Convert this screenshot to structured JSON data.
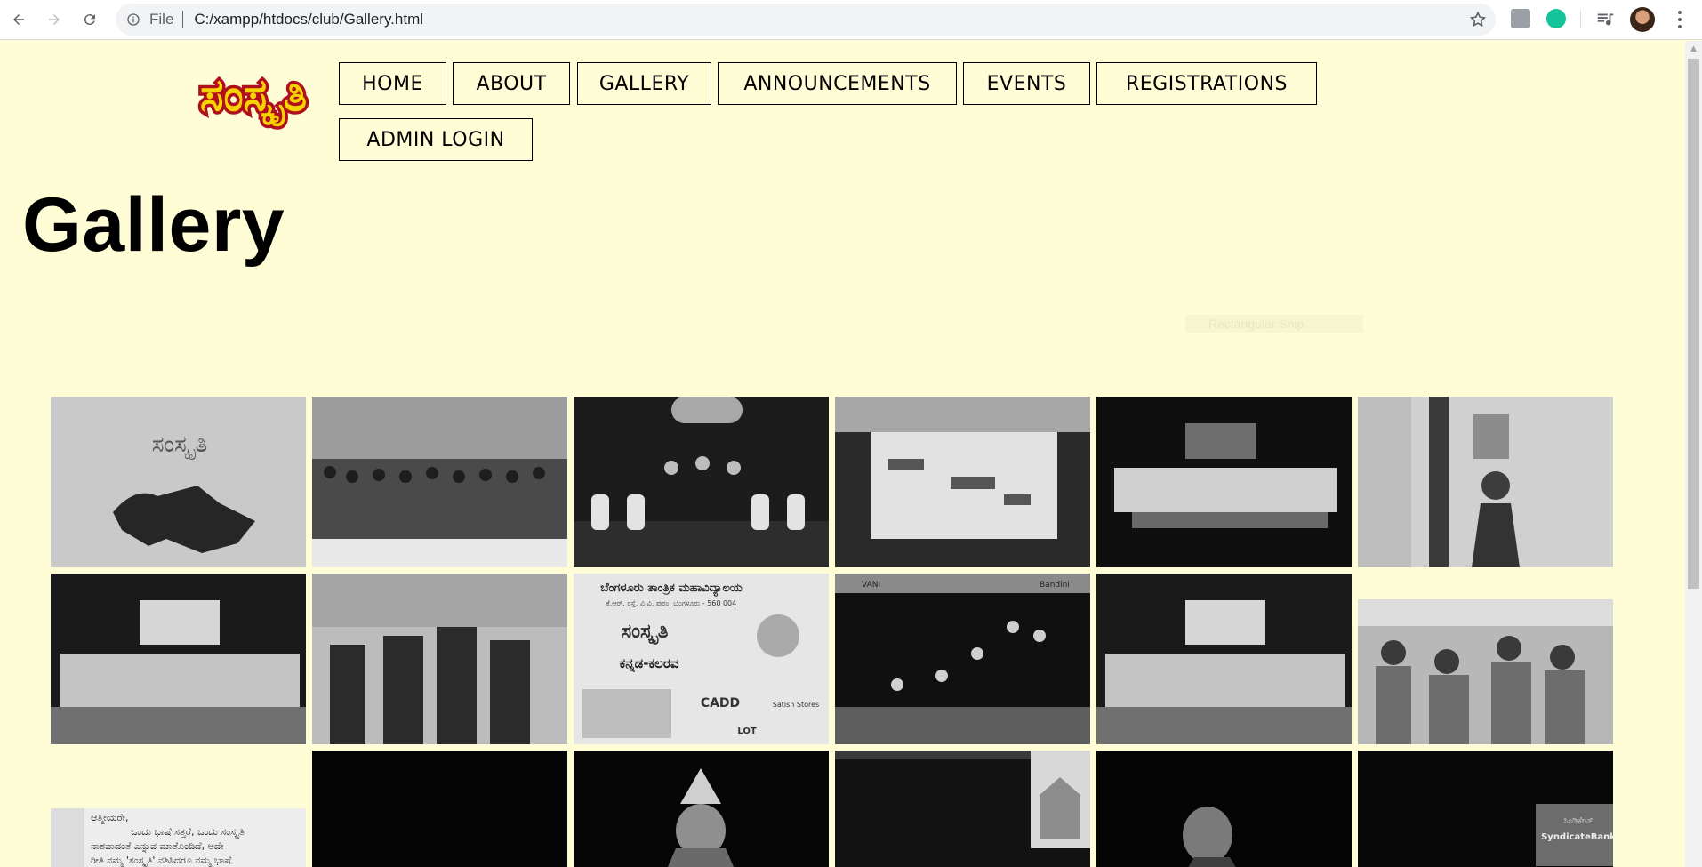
{
  "browser": {
    "scheme": "File",
    "url": "C:/xampp/htdocs/club/Gallery.html"
  },
  "site": {
    "logo_text": "ಸಂಸ್ಕೃತಿ",
    "logo_colors": {
      "fill": "#f5d400",
      "outline": "#b0101e"
    },
    "nav": [
      {
        "label": "HOME"
      },
      {
        "label": "ABOUT"
      },
      {
        "label": "GALLERY"
      },
      {
        "label": "ANNOUNCEMENTS"
      },
      {
        "label": "EVENTS"
      },
      {
        "label": "REGISTRATIONS"
      },
      {
        "label": "ADMIN LOGIN"
      }
    ]
  },
  "page": {
    "title": "Gallery",
    "faint_overlay": "Rectangular Snip"
  },
  "gallery": {
    "photos": [
      {
        "name": "karnataka-map-photo"
      },
      {
        "name": "folk-dancers-group-photo"
      },
      {
        "name": "stage-dance-photo"
      },
      {
        "name": "rotated-performer-photo"
      },
      {
        "name": "stage-group-photo"
      },
      {
        "name": "classical-dancer-photo"
      },
      {
        "name": "team-stage-photo"
      },
      {
        "name": "guests-group-photo"
      },
      {
        "name": "event-poster-photo"
      },
      {
        "name": "acrobatic-dance-photo"
      },
      {
        "name": "team-stage-photo-2"
      },
      {
        "name": "crowd-photo"
      },
      {
        "name": "kannada-letter-photo"
      },
      {
        "name": "dark-stage-photo"
      },
      {
        "name": "yakshagana-photo"
      },
      {
        "name": "temple-backdrop-photo"
      },
      {
        "name": "singer-photo"
      },
      {
        "name": "bank-banner-photo"
      }
    ]
  },
  "letter_snippet": {
    "lines": [
      "ಆತ್ಮೀಯರೇ,",
      "ಒಂದು ಭಾಷೆ ಸತ್ತರೆ, ಒಂದು ಸಂಸ್ಕೃತಿ",
      "ನಾಶವಾದಂತೆ ಎನ್ನುವ ಮಾತೊಂದಿದೆ, ಅದೇ",
      "ರೀತಿ ನಮ್ಮ 'ಸಂಸ್ಕೃತಿ' ನಶಿಸಿದರೂ ನಮ್ಮ ಭಾಷೆ"
    ]
  },
  "poster_snippet": {
    "college": "ಬೆಂಗಳೂರು ತಾಂತ್ರಿಕ ಮಹಾವಿದ್ಯಾಲಯ",
    "address": "ಕೆ.ಆರ್. ರಸ್ತೆ, ವಿ.ವಿ. ಪುರಂ, ಬೆಂಗಳೂರು - 560 004",
    "logo": "ಸಂಸ್ಕೃತಿ",
    "event": "ಕನ್ನಡ-ಕಲರವ",
    "sponsor1": "CADD",
    "sponsor2": "Satish Stores",
    "sponsor3": "LOT",
    "banner_top": "VANI",
    "banner_right": "Bandini"
  },
  "bank_snippet": {
    "line1": "ಸಿಂಡಿಕೇಟ್",
    "line2": "SyndicateBank"
  }
}
